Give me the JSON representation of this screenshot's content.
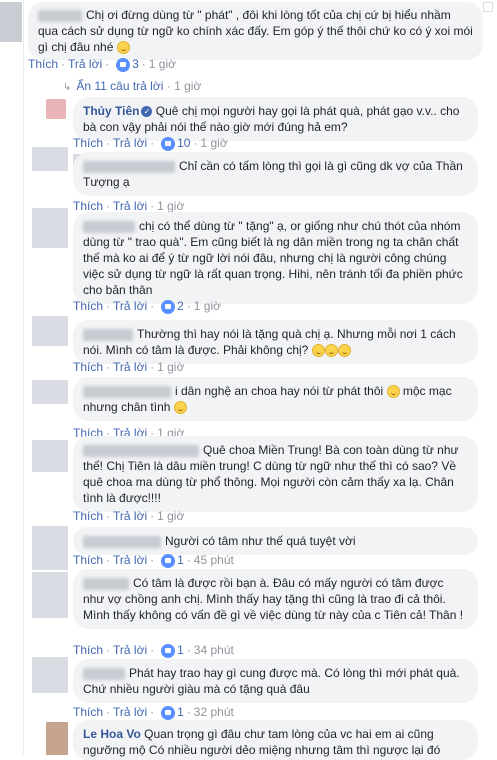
{
  "comments": [
    {
      "id": "c0",
      "text": "Chị ơi đừng dùng từ \" phát\" , đôi khi lòng tốt của chị cứ bị hiểu nhầm qua cách sử dụng từ ngữ ko chính xác đấy. Em góp ý thế thôi chứ ko có ý xoi mói gì chị đâu nhé",
      "like": "Thích",
      "reply": "Trả lời",
      "reactions": "3",
      "time": "1 giờ"
    },
    {
      "id": "c1",
      "author": "Thủy Tiên",
      "text": "Quê chị mọi người hay gọi là phát quà, phát gạo v.v.. cho bà con vậy phải nói thế nào giờ mới đúng hả em?",
      "like": "Thích",
      "reply": "Trả lời",
      "reactions": "10",
      "time": "1 giờ"
    },
    {
      "id": "c2",
      "text": "Chỉ cần có tấm lòng thì gọi là gì cũng dk vợ của Thần Tượng ạ",
      "like": "Thích",
      "reply": "Trả lời",
      "time": "1 giờ"
    },
    {
      "id": "c3",
      "text": "chị có thể dùng từ \" tặng\" ạ, or giống như chú thót của nhóm dùng từ \" trao quà\". Em cũng biết là ng dân miền trong ng ta chân chất thế mà ko ai để ý từ ngữ lời nói đâu, nhưng chị là người công chúng việc sử dụng từ ngữ là rất quan trọng. Hihi, nên tránh tối đa phiền phức cho bản thân",
      "like": "Thích",
      "reply": "Trả lời",
      "reactions": "2",
      "time": "1 giờ"
    },
    {
      "id": "c4",
      "text": "Thường thì hay nói là tặng quà chị ạ. Nhưng mỗi nơi 1 cách nói. Mình có tâm là được. Phải không chị?",
      "like": "Thích",
      "reply": "Trả lời",
      "time": "1 giờ"
    },
    {
      "id": "c5",
      "text": "i dân nghệ an choa hay nói từ phát thôi",
      "text2": "mộc mạc nhưng chân tình",
      "like": "Thích",
      "reply": "Trả lời",
      "time": "1 giờ"
    },
    {
      "id": "c6",
      "text": "Quê choa Miền Trung! Bà con toàn dùng từ như thế! Chị Tiên là dâu miền trung! C dùng từ ngữ như thế thì có sao? Về quê choa ma dùng từ phổ thông. Mọi người còn cảm thấy xa lạ. Chân tình là được!!!!",
      "like": "Thích",
      "reply": "Trả lời",
      "time": "1 giờ"
    },
    {
      "id": "c7",
      "text": "Người có tâm như thế quá tuyệt vời",
      "like": "Thích",
      "reply": "Trả lời",
      "reactions": "1",
      "time": "45 phút"
    },
    {
      "id": "c8",
      "text": "Có tâm là được rồi bạn à. Đâu có mấy người có tâm được như vợ chồng anh chị. Mình thấy hay tặng thì cũng là trao đi cả thôi. Mình thấy không có vấn đề gì về việc dùng từ này của c Tiên cả! Thân !",
      "like": "Thích",
      "reply": "Trả lời",
      "reactions": "1",
      "time": "34 phút"
    },
    {
      "id": "c9",
      "text": "Phát hay trao hay gì cung được mà. Có lòng thì mới phát quà. Chứ nhiều người giàu mà có tặng quà đâu",
      "like": "Thích",
      "reply": "Trả lời",
      "reactions": "1",
      "time": "32 phút"
    },
    {
      "id": "c10",
      "author": "Le Hoa Vo",
      "text": "Quan trọng gì đâu chư tam lòng của vc hai em ai cũng ngưỡng mộ Có nhiều người dẻo miệng nhưng tâm thì ngược lại đó"
    }
  ],
  "hide_replies": "Ẩn 11 câu trả lời",
  "hide_replies_time": "1 giờ",
  "colors": {
    "link": "#4267b2",
    "name": "#365899",
    "bubble": "#f2f3f5",
    "meta": "#90949c",
    "reaction": "#5890ff"
  }
}
